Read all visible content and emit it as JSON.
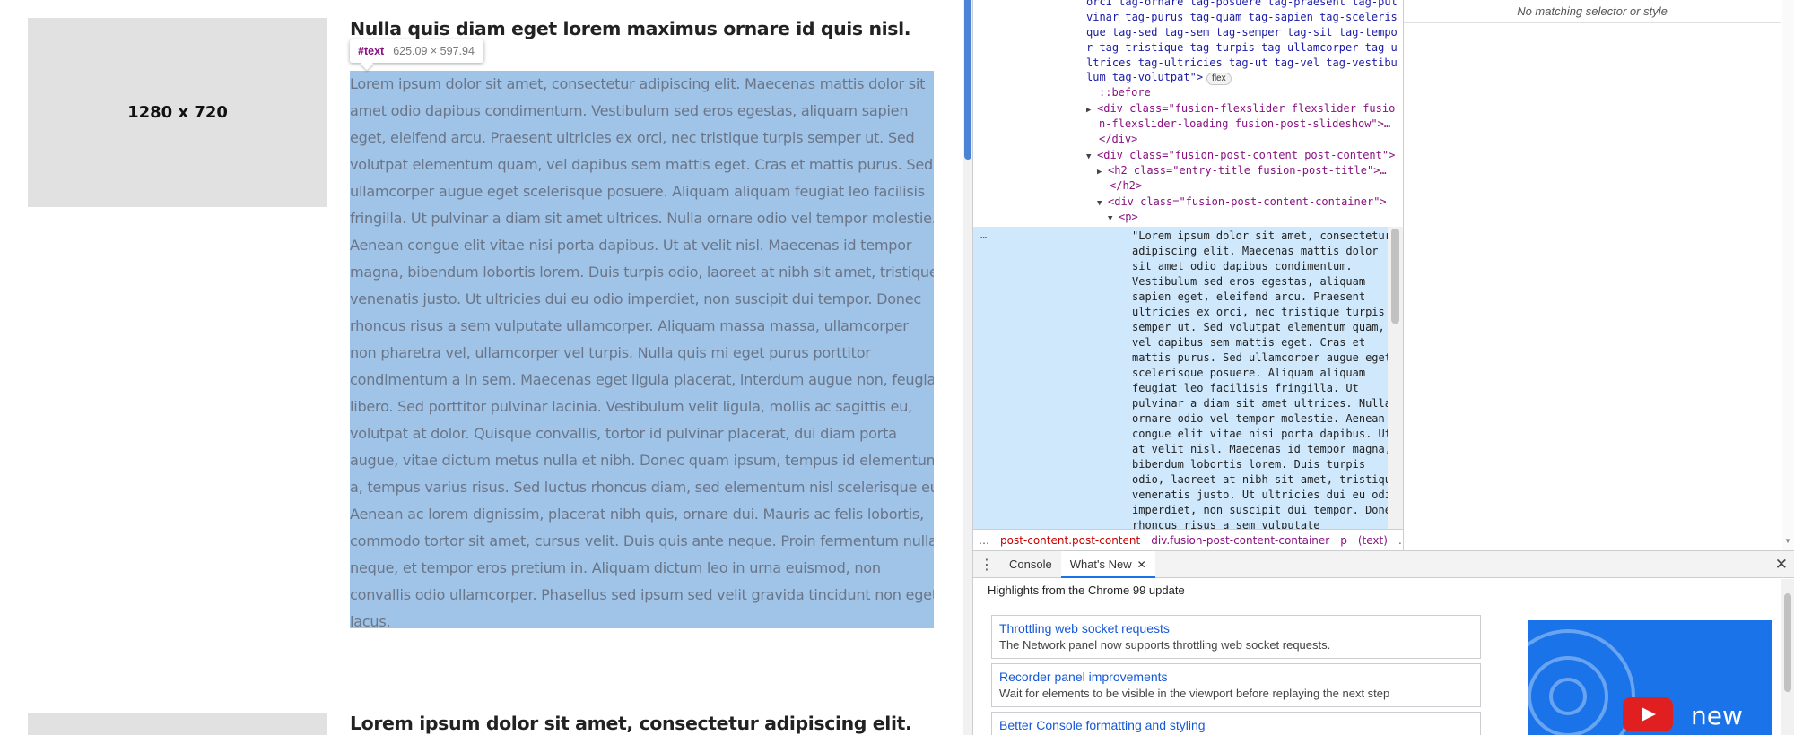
{
  "page": {
    "thumbnail_label": "1280 x 720",
    "post1_title": "Nulla quis diam eget lorem maximus ornare id quis nisl.",
    "post2_title": "Lorem ipsum dolor sit amet, consectetur adipiscing elit.",
    "tooltip": {
      "name": "#text",
      "size": "625.09 × 597.94"
    },
    "body_lines": [
      "Lorem ipsum dolor sit amet, consectetur adipiscing elit. Maecenas mattis dolor sit",
      "amet odio dapibus condimentum. Vestibulum sed eros egestas, aliquam sapien",
      "eget, eleifend arcu. Praesent ultricies ex orci, nec tristique turpis semper ut. Sed",
      "volutpat elementum quam, vel dapibus sem mattis eget. Cras et mattis purus. Sed",
      "ullamcorper augue eget scelerisque posuere. Aliquam aliquam feugiat leo facilisis",
      "fringilla. Ut pulvinar a diam sit amet ultrices. Nulla ornare odio vel tempor molestie.",
      "Aenean congue elit vitae nisi porta dapibus. Ut at velit nisl. Maecenas id tempor",
      "magna, bibendum lobortis lorem. Duis turpis odio, laoreet at nibh sit amet, tristique",
      "venenatis justo. Ut ultricies dui eu odio imperdiet, non suscipit dui tempor. Donec",
      "rhoncus risus a sem vulputate ullamcorper. Aliquam massa massa, ullamcorper",
      "non pharetra vel, ullamcorper vel turpis. Nulla quis mi eget purus porttitor",
      "condimentum a in sem. Maecenas eget ligula placerat, interdum augue non, feugiat",
      "libero. Sed porttitor pulvinar lacinia. Vestibulum velit ligula, mollis ac sagittis eu,",
      "volutpat at dolor. Quisque convallis, tortor id pulvinar placerat, dui diam porta",
      "augue, vitae dictum metus nulla et nibh. Donec quam ipsum, tempus id elementum",
      "a, tempus varius risus. Sed luctus rhoncus diam, sed elementum nisl scelerisque eu.",
      "Aenean ac lorem dignissim, placerat nibh quis, ornare dui. Mauris ac felis lobortis,",
      "commodo tortor sit amet, cursus velit. Duis quis ante neque. Proin fermentum nulla",
      "neque, et tempor eros pretium in. Aliquam dictum leo in urna euismod, non",
      "convallis odio ullamcorper. Phasellus sed ipsum sed velit gravida tincidunt non eget",
      "lacus."
    ]
  },
  "elements": {
    "class_lines": [
      "orci tag-ornare tag-posuere tag-praesent tag-pul",
      "vinar tag-purus tag-quam tag-sapien tag-sceleris",
      "que tag-sed tag-sem tag-semper tag-sit tag-tempo",
      "r tag-tristique tag-turpis tag-ullamcorper tag-u",
      "ltrices tag-ultricies tag-ut tag-vel tag-vestibu",
      "lum tag-volutpat\">"
    ],
    "flex_badge": "flex",
    "before": "::before",
    "flexslider_open": "<div class=\"fusion-flexslider flexslider fusio",
    "flexslider_cont": "n-flexslider-loading fusion-post-slideshow\">…",
    "div_close": "</div>",
    "post_content": "<div class=\"fusion-post-content post-content\">",
    "h2_open": "<h2 class=\"entry-title fusion-post-title\">…",
    "h2_close": "</h2>",
    "content_container": "<div class=\"fusion-post-content-container\">",
    "p_open": "<p>",
    "selected_dots": "…",
    "selected_lines": [
      "\"Lorem ipsum dolor sit amet, consectetur",
      "adipiscing elit. Maecenas mattis dolor",
      "sit amet odio dapibus condimentum.",
      "Vestibulum sed eros egestas, aliquam",
      "sapien eget, eleifend arcu. Praesent",
      "ultricies ex orci, nec tristique turpis",
      "semper ut. Sed volutpat elementum quam,",
      "vel dapibus sem mattis eget. Cras et",
      "mattis purus. Sed ullamcorper augue eget",
      "scelerisque posuere. Aliquam aliquam",
      "feugiat leo facilisis fringilla. Ut",
      "pulvinar a diam sit amet ultrices. Nulla",
      "ornare odio vel tempor molestie. Aenean",
      "congue elit vitae nisi porta dapibus. Ut",
      "at velit nisl. Maecenas id tempor magna,",
      "bibendum lobortis lorem. Duis turpis",
      "odio, laoreet at nibh sit amet, tristique",
      "venenatis justo. Ut ultricies dui eu odio",
      "imperdiet, non suscipit dui tempor. Donec",
      "rhoncus risus a sem vulputate"
    ]
  },
  "breadcrumb": {
    "dots": "…",
    "item1": "post-content.post-content",
    "item2": "div.fusion-post-content-container",
    "item3": "p",
    "item4": "(text)",
    "end_dots": "…"
  },
  "styles": {
    "no_match": "No matching selector or style"
  },
  "drawer": {
    "tab_console": "Console",
    "tab_whats_new": "What's New",
    "header": "Highlights from the Chrome 99 update",
    "features": [
      {
        "title": "Throttling web socket requests",
        "desc": "The Network panel now supports throttling web socket requests."
      },
      {
        "title": "Recorder panel improvements",
        "desc": "Wait for elements to be visible in the viewport before replaying the next step"
      },
      {
        "title": "Better Console formatting and styling",
        "desc": ""
      }
    ],
    "promo_text": "new"
  }
}
